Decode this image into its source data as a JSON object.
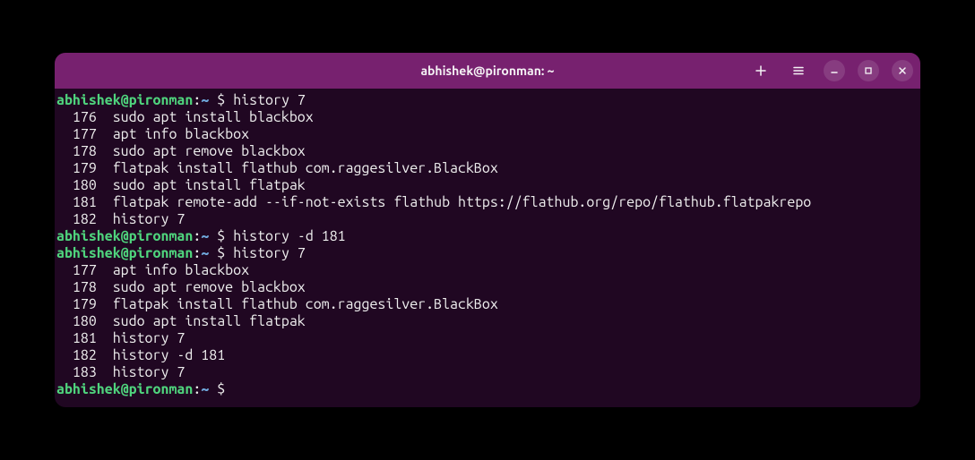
{
  "window": {
    "title": "abhishek@pironman: ~"
  },
  "prompt": {
    "user": "abhishek",
    "at": "@",
    "host": "pironman",
    "colon": ":",
    "path": "~",
    "symbol": "$"
  },
  "blocks": [
    {
      "command": "history 7",
      "output": [
        {
          "num": "176",
          "cmd": "sudo apt install blackbox"
        },
        {
          "num": "177",
          "cmd": "apt info blackbox"
        },
        {
          "num": "178",
          "cmd": "sudo apt remove blackbox"
        },
        {
          "num": "179",
          "cmd": "flatpak install flathub com.raggesilver.BlackBox"
        },
        {
          "num": "180",
          "cmd": "sudo apt install flatpak"
        },
        {
          "num": "181",
          "cmd": "flatpak remote-add --if-not-exists flathub https://flathub.org/repo/flathub.flatpakrepo"
        },
        {
          "num": "182",
          "cmd": "history 7"
        }
      ]
    },
    {
      "command": "history -d 181",
      "output": []
    },
    {
      "command": "history 7",
      "output": [
        {
          "num": "177",
          "cmd": "apt info blackbox"
        },
        {
          "num": "178",
          "cmd": "sudo apt remove blackbox"
        },
        {
          "num": "179",
          "cmd": "flatpak install flathub com.raggesilver.BlackBox"
        },
        {
          "num": "180",
          "cmd": "sudo apt install flatpak"
        },
        {
          "num": "181",
          "cmd": "history 7"
        },
        {
          "num": "182",
          "cmd": "history -d 181"
        },
        {
          "num": "183",
          "cmd": "history 7"
        }
      ]
    },
    {
      "command": "",
      "output": []
    }
  ]
}
